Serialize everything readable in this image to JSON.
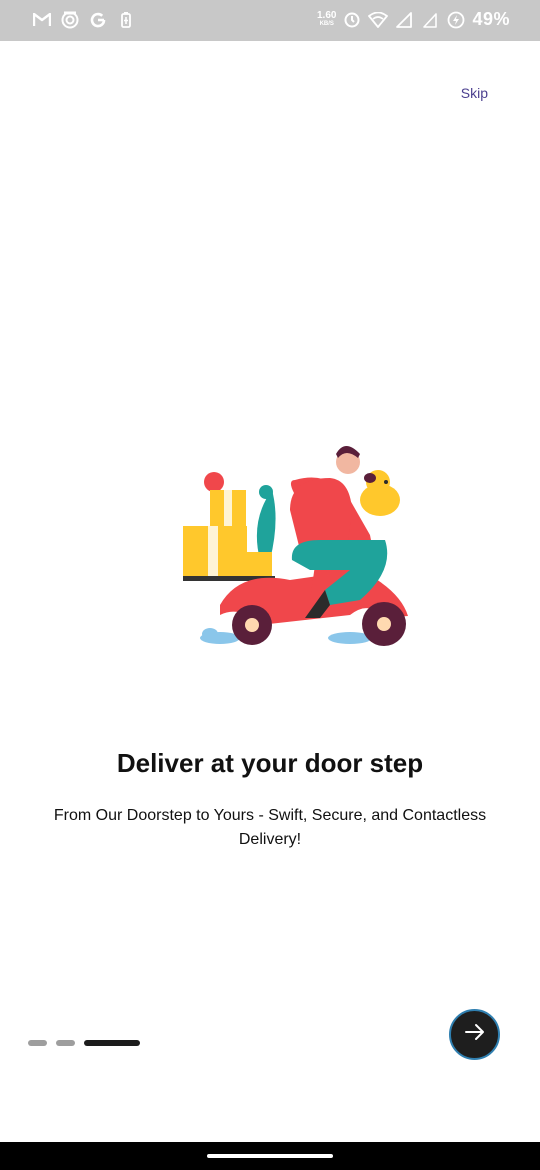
{
  "status_bar": {
    "left_icons": [
      "gmail-icon",
      "camera-icon",
      "google-icon",
      "battery-saver-icon"
    ],
    "net_speed_value": "1.60",
    "net_speed_unit": "KB/S",
    "right_icons": [
      "alarm-icon",
      "wifi-icon",
      "signal-icon",
      "signal-icon",
      "battery-icon"
    ],
    "battery_percent": "49%"
  },
  "onboarding": {
    "skip_label": "Skip",
    "illustration": "delivery-scooter-illustration",
    "title": "Deliver at your door step",
    "subtitle": "From Our Doorstep to Yours - Swift, Secure, and Contactless Delivery!",
    "page_indicator": {
      "total": 3,
      "active_index": 2
    },
    "next_button_icon": "arrow-right-icon"
  },
  "colors": {
    "accent": "#4b3f8f",
    "button_bg": "#1e1e1e",
    "button_border": "#2f7fb0",
    "scooter_red": "#f0474b",
    "box_yellow": "#ffc82c",
    "shirt_teal": "#1fa39b"
  }
}
